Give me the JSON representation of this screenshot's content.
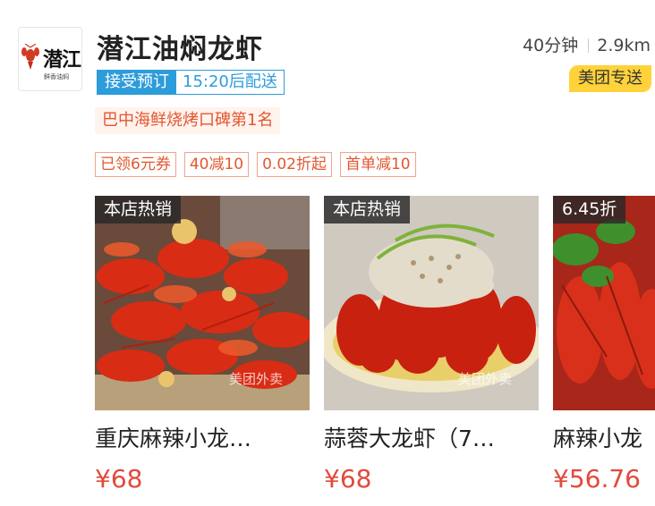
{
  "shop": {
    "logo": {
      "brand_text": "潜江",
      "sub_text": "鲜香油焖"
    },
    "name": "潜江油焖龙虾",
    "delivery_time": "40分钟",
    "distance": "2.9km",
    "order_tag": {
      "status": "接受预订",
      "delivery": "15:20后配送"
    },
    "delivery_badge": "美团专送",
    "rank": "巴中海鲜烧烤口碑第1名",
    "coupons": [
      "已领6元券",
      "40减10",
      "0.02折起",
      "首单减10"
    ]
  },
  "products": [
    {
      "label": "本店热销",
      "name": "重庆麻辣小龙…",
      "price": "¥68",
      "watermark": "美团外卖"
    },
    {
      "label": "本店热销",
      "name": "蒜蓉大龙虾（7…",
      "price": "¥68",
      "watermark": "美团外卖"
    },
    {
      "label": "6.45折",
      "name": "麻辣小龙",
      "price": "¥56.76",
      "watermark": ""
    }
  ],
  "colors": {
    "accent_blue": "#2d9cdb",
    "badge_yellow": "#ffd23a",
    "price_red": "#e24a3b",
    "coupon_red": "#e2572f"
  }
}
